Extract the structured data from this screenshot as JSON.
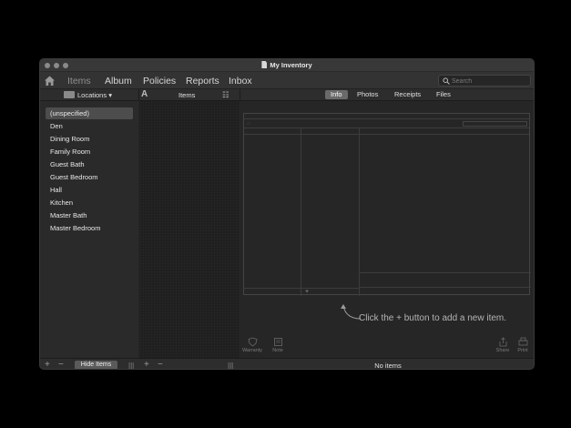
{
  "window": {
    "title": "My Inventory"
  },
  "nav": {
    "tabs": [
      {
        "label": "Items",
        "active": true
      },
      {
        "label": "Album",
        "active": false
      },
      {
        "label": "Policies",
        "active": false
      },
      {
        "label": "Reports",
        "active": false
      },
      {
        "label": "Inbox",
        "active": false
      }
    ],
    "search_placeholder": "Search"
  },
  "columns": {
    "locations_label": "Locations ▾",
    "sort_label": "A",
    "items_label": "Items",
    "view_toggle": "☷"
  },
  "detail_tabs": [
    {
      "label": "Info",
      "active": true
    },
    {
      "label": "Photos",
      "active": false
    },
    {
      "label": "Receipts",
      "active": false
    },
    {
      "label": "Files",
      "active": false
    }
  ],
  "sidebar": {
    "items": [
      {
        "label": "(unspecified)",
        "selected": true
      },
      {
        "label": "Den"
      },
      {
        "label": "Dining Room"
      },
      {
        "label": "Family Room"
      },
      {
        "label": "Guest Bath"
      },
      {
        "label": "Guest Bedroom"
      },
      {
        "label": "Hall"
      },
      {
        "label": "Kitchen"
      },
      {
        "label": "Master Bath"
      },
      {
        "label": "Master Bedroom"
      }
    ]
  },
  "hint": {
    "text": "Click the + button to add a new item."
  },
  "tools": {
    "warranty": "Warranty",
    "note": "Note",
    "share": "Share",
    "print": "Print"
  },
  "bottom": {
    "add": "+",
    "remove": "−",
    "hide_items": "Hide Items",
    "grip": "|||",
    "status": "No items"
  },
  "colors": {
    "window_bg": "#262626",
    "toolbar_bg": "#333333",
    "selected_bg": "#4d4d4d",
    "active_tab_bg": "#6a6a6a"
  }
}
